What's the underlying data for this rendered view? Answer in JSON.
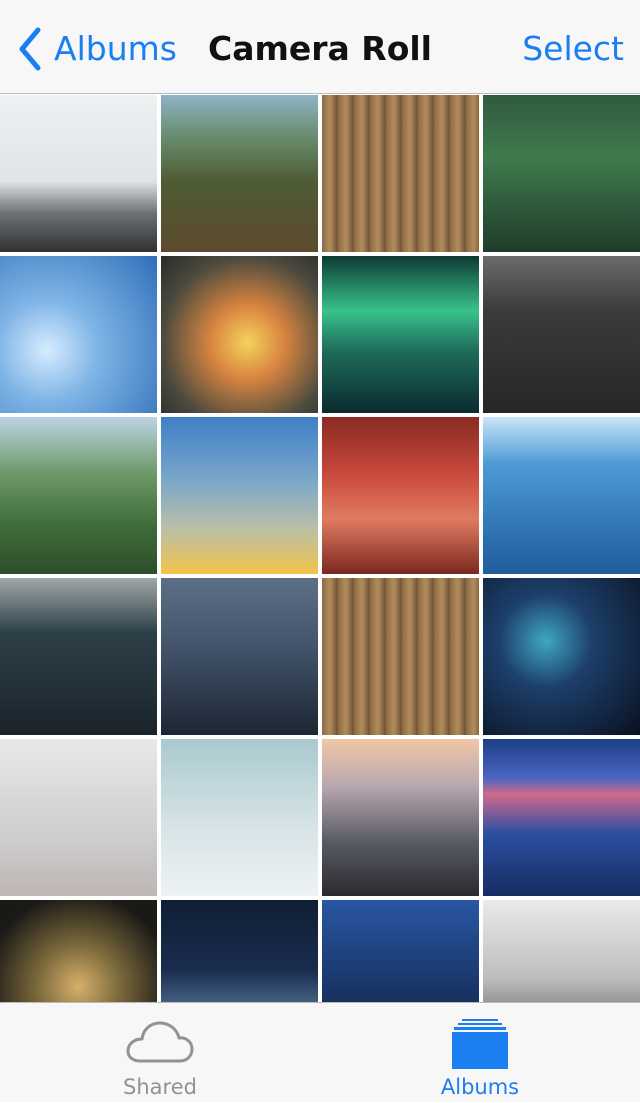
{
  "nav": {
    "back_label": "Albums",
    "title": "Camera Roll",
    "select_label": "Select"
  },
  "photos": [
    {
      "name": "photo-foggy-mountain",
      "bg": "linear-gradient(180deg,#eef1f2 0%,#dfe4e6 55%,#6f7275 75%,#2f3133 100%)"
    },
    {
      "name": "photo-turf-roof-cabin",
      "bg": "linear-gradient(180deg,#8fb3c7 0%,#6a8f72 25%,#4e5c34 55%,#5d4a2c 100%)"
    },
    {
      "name": "photo-tree-trunks",
      "bg": "repeating-linear-gradient(90deg,#8b6b45 0px,#b28c5c 8px,#6d5234 16px)"
    },
    {
      "name": "photo-green-forest-art",
      "bg": "linear-gradient(180deg,#2f5a3e 0%,#3f7a4d 40%,#1f3c2a 100%)"
    },
    {
      "name": "photo-ice-bubbles",
      "bg": "radial-gradient(circle at 30% 60%,#d6ecff 0%,#7fb4e6 35%,#2f6fb8 100%)"
    },
    {
      "name": "photo-colorful-installation",
      "bg": "radial-gradient(circle at 55% 55%,#f5d35c 0%,#d88540 30%,#4b4a3e 70%,#2a2a2a 100%)"
    },
    {
      "name": "photo-aurora-mountain",
      "bg": "linear-gradient(180deg,#0d3a34 0%,#39c28a 35%,#1f6d5c 60%,#0b2b2f 100%)"
    },
    {
      "name": "photo-dark-landscape",
      "bg": "linear-gradient(180deg,#6b6b6d 0%,#3a3b3d 35%,#252628 100%)"
    },
    {
      "name": "photo-green-valley",
      "bg": "linear-gradient(180deg,#bcd3e4 0%,#6f9a6a 35%,#3e6b3a 70%,#2d4e2a 100%)"
    },
    {
      "name": "photo-blue-yellow-gradient",
      "bg": "linear-gradient(180deg,#3f7fc7 0%,#7aa6c9 40%,#b8bfa9 70%,#f2c34a 100%)"
    },
    {
      "name": "photo-red-canyon-art",
      "bg": "linear-gradient(180deg,#8a2a22 0%,#c7473b 35%,#e07b61 65%,#7a2820 100%)"
    },
    {
      "name": "photo-frozen-lake",
      "bg": "linear-gradient(180deg,#c8e6f7 0%,#4c9ad6 30%,#1f5c9c 100%)"
    },
    {
      "name": "photo-treehouse-forest",
      "bg": "linear-gradient(180deg,#a0a8a8 0%,#2d3f48 35%,#1a242a 100%)"
    },
    {
      "name": "photo-geometric-star",
      "bg": "linear-gradient(180deg,#5d6f86 0%,#425369 45%,#1c2633 100%)"
    },
    {
      "name": "photo-tree-trunks-2",
      "bg": "repeating-linear-gradient(90deg,#8b6b45 0px,#b28c5c 8px,#6d5234 16px)"
    },
    {
      "name": "photo-space-man",
      "bg": "radial-gradient(circle at 40% 40%,#3fa7c3 0%,#1d3f6a 35%,#0a1020 100%)"
    },
    {
      "name": "photo-misty-forest",
      "bg": "linear-gradient(180deg,#e8e8e9 0%,#cfcfd1 60%,#bdb6b3 100%)"
    },
    {
      "name": "photo-pale-teal-sky",
      "bg": "linear-gradient(180deg,#a9c9cf 0%,#d6e3e6 55%,#eef3f4 100%)"
    },
    {
      "name": "photo-seascape-rocks",
      "bg": "linear-gradient(180deg,#f1c7a6 0%,#b8a7b0 30%,#5a5c66 65%,#2a2a2e 100%)"
    },
    {
      "name": "photo-matterhorn-reflection",
      "bg": "linear-gradient(180deg,#1b3e86 0%,#4c66c0 25%,#d06a8d 35%,#2c4fa1 60%,#162d63 100%)"
    },
    {
      "name": "photo-bokeh-tree",
      "bg": "radial-gradient(circle at 50% 55%,#d7b06b 0%,#7c6a3c 35%,#1a1916 80%)"
    },
    {
      "name": "photo-burj-khalifa-fog",
      "bg": "linear-gradient(180deg,#0f1e33 0%,#1a2d4f 45%,#4d6b8c 70%,#c7b7a2 100%)"
    },
    {
      "name": "photo-milky-way",
      "bg": "linear-gradient(180deg,#2a56a3 0%,#1d3f79 40%,#0f1d3a 100%)"
    },
    {
      "name": "photo-snowy-pines",
      "bg": "linear-gradient(180deg,#eaeaea 0%,#bdbdbd 50%,#3d3d3d 100%)"
    }
  ],
  "tabs": {
    "shared_label": "Shared",
    "albums_label": "Albums"
  },
  "colors": {
    "accent": "#1b7ff2",
    "inactive": "#929292"
  }
}
